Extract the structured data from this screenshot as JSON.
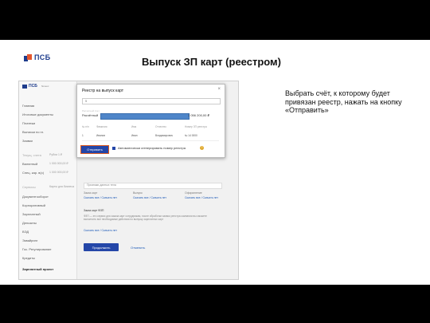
{
  "slide": {
    "logo_text": "ПСБ",
    "title": "Выпуск ЗП карт (реестром)",
    "instruction": "Выбрать счёт, к которому будет привязан реестр, нажать на кнопку «Отправить»"
  },
  "app": {
    "logo_text": "ПСБ",
    "logo_sub": "бизнес",
    "sidebar": [
      {
        "label": "Главная",
        "value": ""
      },
      {
        "label": "Итоговые документы",
        "value": ""
      },
      {
        "label": "Платежи",
        "value": ""
      },
      {
        "label": "Выписки по гл.",
        "value": ""
      },
      {
        "label": "Заявки",
        "value": ""
      },
      {
        "label": "Текущ. счета",
        "value": "Рубли 1 ₽"
      },
      {
        "label": "Валютный",
        "value": "1 000 000,00 ₽"
      },
      {
        "label": "Спец. кар. в(с)",
        "value": "1 000 000,00 ₽"
      },
      {
        "label": "Сервисы",
        "value": "Карты для бизнеса"
      },
      {
        "label": "Документооборот",
        "value": ""
      },
      {
        "label": "Корпоративный",
        "value": ""
      },
      {
        "label": "Зарплатный",
        "value": ""
      },
      {
        "label": "Депозиты",
        "value": ""
      },
      {
        "label": "ВЭД",
        "value": ""
      },
      {
        "label": "Эквайринг",
        "value": ""
      },
      {
        "label": "Гос. Регулирование",
        "value": ""
      },
      {
        "label": "Кредиты",
        "value": ""
      },
      {
        "label": "Зарплатный проект",
        "value": ""
      }
    ],
    "main": {
      "select_placeholder": "Признаки данных тела",
      "col1_label": "Заказ карт",
      "col1_link": "Скачать все / Скачать нет",
      "col2_label": "Выпуск",
      "col2_link": "Скачать все / Скачать нет",
      "col3_label": "Оформление",
      "col3_link": "Скачать все / Скачать нет",
      "section_label": "Заказ карт ФЗП",
      "section_text": "ФЗП — это сервис для заказа карт сотрудникам, после обработки заявок реестра компании вы сможете выполнить все необходимые действия по выпуску зарплатных карт",
      "section_link": "Скачать все / Скачать нет",
      "primary_button": "Продолжить",
      "secondary_button": "Отменить"
    },
    "dialog": {
      "title": "Реестр на выпуск карт",
      "close": "×",
      "search_value": "5",
      "account_label": "Расчетный счет",
      "account_value": "Расчётный",
      "account_amount": "1 056 200,00 ₽",
      "table": {
        "headers": [
          "№ п/п",
          "Фамилия",
          "Имя",
          "Отчество",
          "Номер ЗП реестра"
        ],
        "row": [
          "1",
          "Иванов",
          "Иван",
          "Владимирович",
          "№ 14 0000"
        ]
      },
      "send_button": "Отправить",
      "auto_sign_label": "Автоматически сгенерировать номер реестра",
      "help_icon": "?"
    }
  }
}
